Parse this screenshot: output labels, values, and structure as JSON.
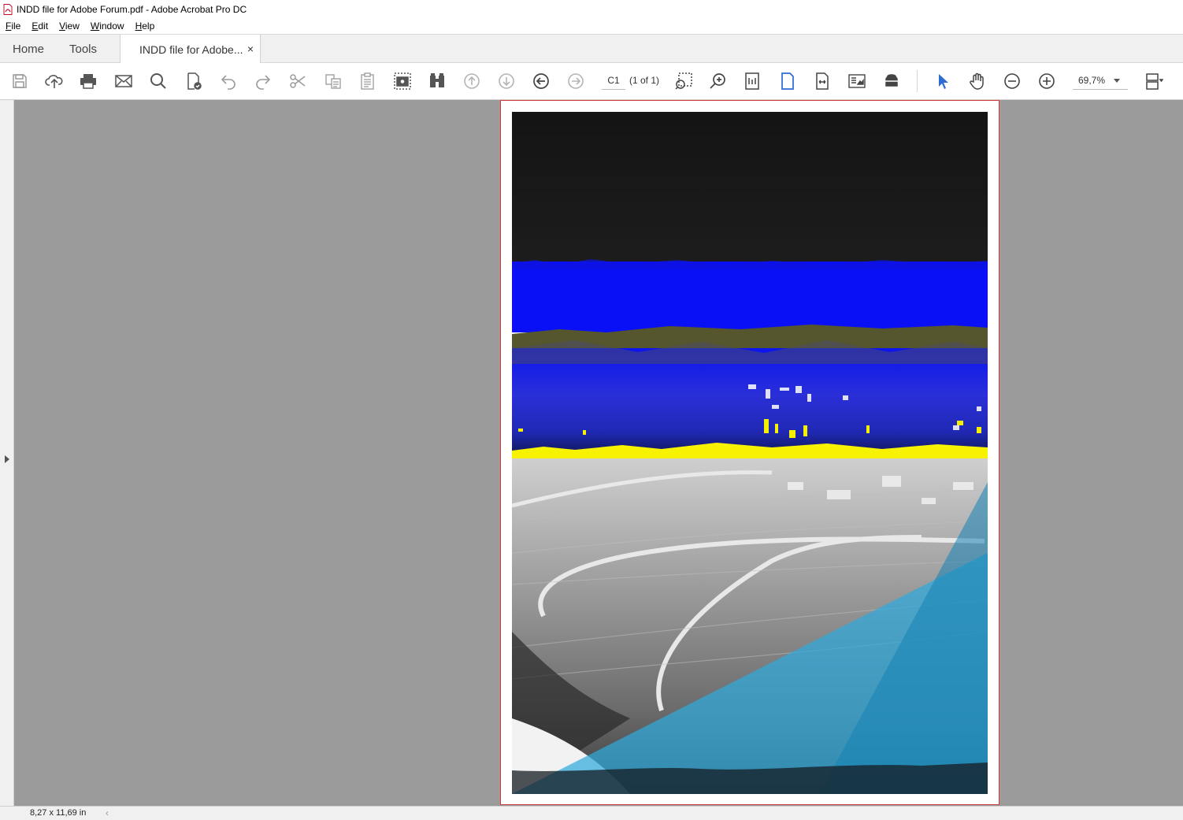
{
  "window": {
    "title": "INDD file for Adobe Forum.pdf - Adobe Acrobat Pro DC"
  },
  "menu": {
    "items": [
      {
        "label": "File",
        "u": "F",
        "rest": "ile"
      },
      {
        "label": "Edit",
        "u": "E",
        "rest": "dit"
      },
      {
        "label": "View",
        "u": "V",
        "rest": "iew"
      },
      {
        "label": "Window",
        "u": "W",
        "rest": "indow"
      },
      {
        "label": "Help",
        "u": "H",
        "rest": "elp"
      }
    ]
  },
  "tabs": {
    "home": "Home",
    "tools": "Tools",
    "document": "INDD file for Adobe...",
    "close": "×"
  },
  "toolbar": {
    "page_number": "C1",
    "page_of": "(1 of 1)",
    "zoom": "69,7%",
    "icons": [
      "save-icon",
      "upload-cloud-icon",
      "print-icon",
      "email-icon",
      "search-icon",
      "protect-icon",
      "undo-icon",
      "redo-icon",
      "cut-icon",
      "copy-icon",
      "paste-icon",
      "snapshot-icon",
      "compare-icon",
      "previous-page-icon",
      "next-page-icon",
      "back-icon",
      "forward-icon",
      "marquee-zoom-icon",
      "zoom-glass-icon",
      "fit-page-icon",
      "single-page-icon",
      "fit-width-icon",
      "scrolling-icon",
      "read-mode-icon",
      "select-tool-icon",
      "hand-tool-icon",
      "zoom-out-icon",
      "zoom-in-icon",
      "page-display-icon"
    ]
  },
  "status": {
    "dimensions": "8,27 x 11,69 in"
  },
  "colors": {
    "accent_blue": "#2c6bd2",
    "page_border": "#d23a3a",
    "workspace": "#9b9b9b"
  }
}
